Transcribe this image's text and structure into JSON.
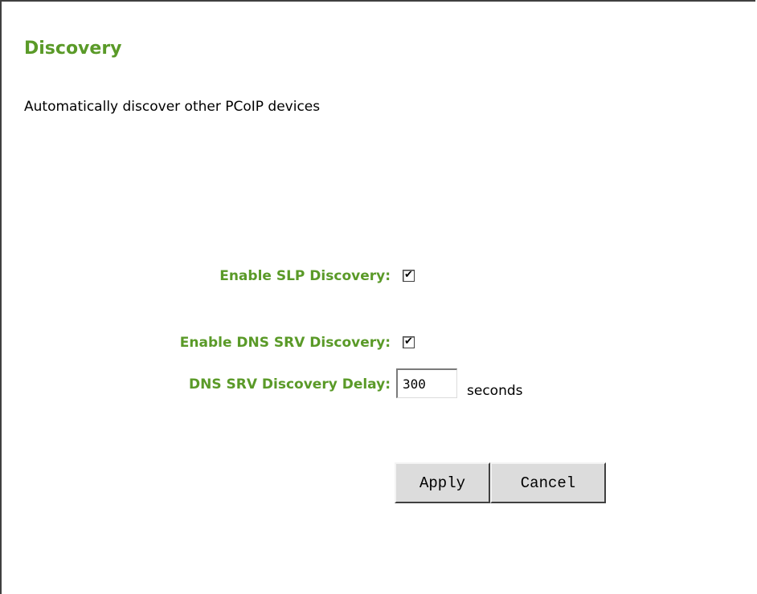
{
  "page": {
    "title": "Discovery",
    "description": "Automatically discover other PCoIP devices"
  },
  "form": {
    "slp_label": "Enable SLP Discovery:",
    "slp_checked": true,
    "dns_srv_label": "Enable DNS SRV Discovery:",
    "dns_srv_checked": true,
    "delay_label": "DNS SRV Discovery Delay:",
    "delay_value": "300",
    "delay_unit": "seconds"
  },
  "buttons": {
    "apply_label": "Apply",
    "cancel_label": "Cancel"
  },
  "colors": {
    "accent_green": "#5a9a28",
    "button_face": "#dcdcdc"
  },
  "icons": {
    "checkmark": "checkmark-icon"
  }
}
